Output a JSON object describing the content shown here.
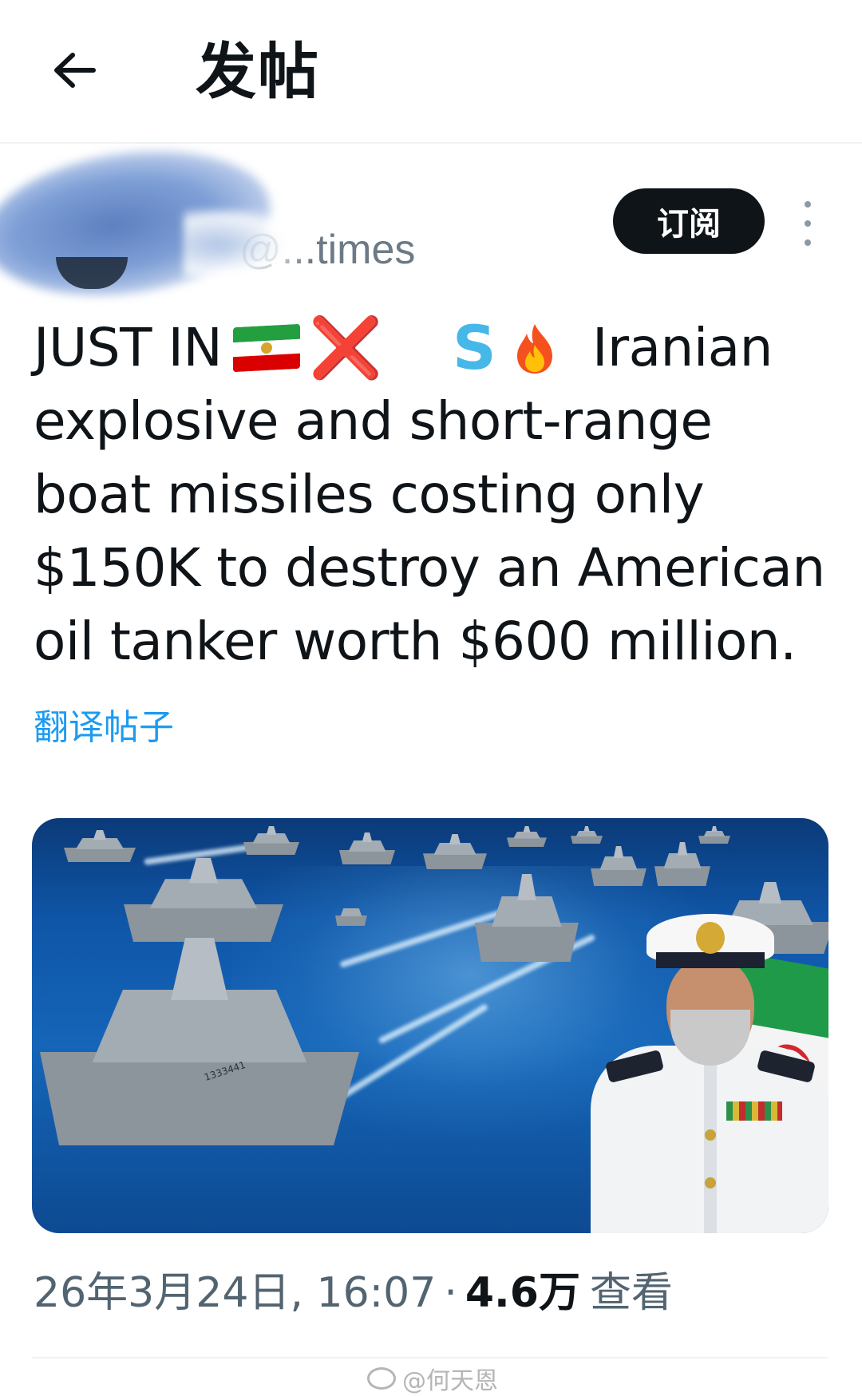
{
  "header": {
    "back_icon": "arrow-left-icon",
    "title": "发帖"
  },
  "author": {
    "handle": "@...times",
    "subscribe_label": "订阅",
    "more_icon": "vertical-ellipsis-icon"
  },
  "tweet": {
    "line1_prefix": "JUST IN",
    "line1_emoji_flag": "iran-flag-emoji",
    "line1_emoji_cross": "❌",
    "line1_emoji_s": "S",
    "line1_emoji_fire": "fire-emoji",
    "line1_suffix": "Iranian",
    "line2": "explosive and short-range",
    "line3": "boat missiles costing only",
    "line4": "$150K to destroy an American",
    "line5": "oil tanker worth $600 million.",
    "translate_label": "翻译帖子"
  },
  "media": {
    "ship_label": "1333441"
  },
  "meta": {
    "time": "26年3月24日, 16:07",
    "separator": "·",
    "views_count": "4.6万",
    "views_label": "查看"
  },
  "watermark": {
    "text": "@何天恩"
  },
  "colors": {
    "link_blue": "#1d9bf0",
    "secondary_text": "#536471",
    "primary_text": "#0f1419",
    "subscribe_bg": "#0f1419"
  }
}
